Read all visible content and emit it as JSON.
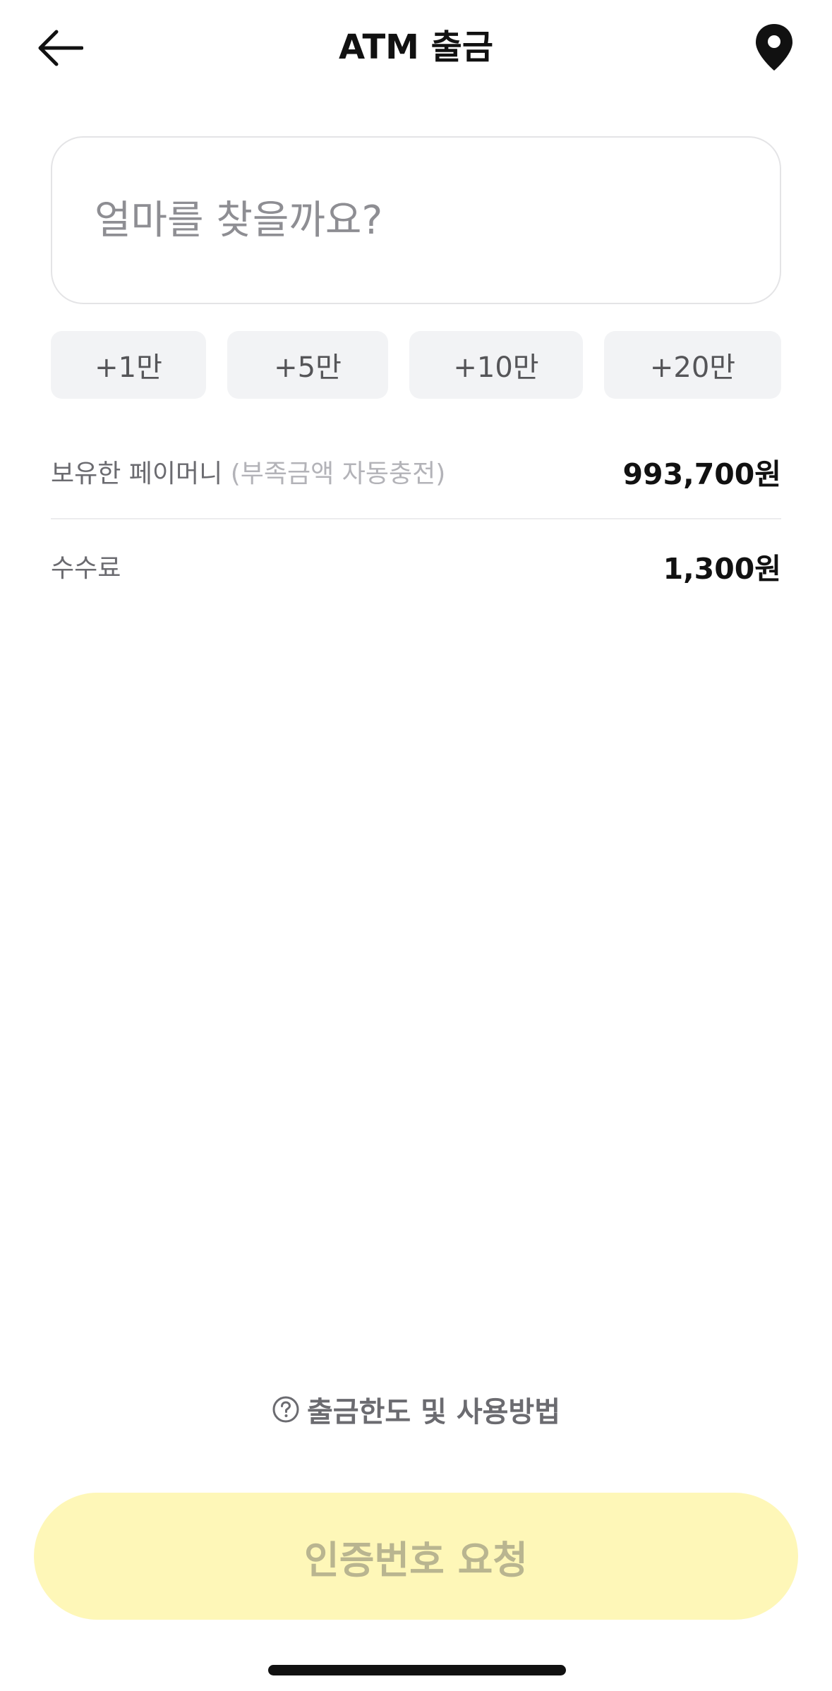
{
  "header": {
    "title": "ATM 출금",
    "back_icon": "arrow-left-icon",
    "location_icon": "map-pin-icon"
  },
  "amount": {
    "placeholder": "얼마를 찾을까요?",
    "value": ""
  },
  "quick_add": [
    {
      "label": "+1만"
    },
    {
      "label": "+5만"
    },
    {
      "label": "+10만"
    },
    {
      "label": "+20만"
    }
  ],
  "balance": {
    "label": "보유한 페이머니",
    "sublabel": "(부족금액 자동충전)",
    "value": "993,700원"
  },
  "fee": {
    "label": "수수료",
    "value": "1,300원"
  },
  "help": {
    "icon": "question-circle-icon",
    "label": "출금한도 및 사용방법"
  },
  "cta": {
    "label": "인증번호 요청",
    "state": "disabled",
    "color": "#fef7b8"
  }
}
